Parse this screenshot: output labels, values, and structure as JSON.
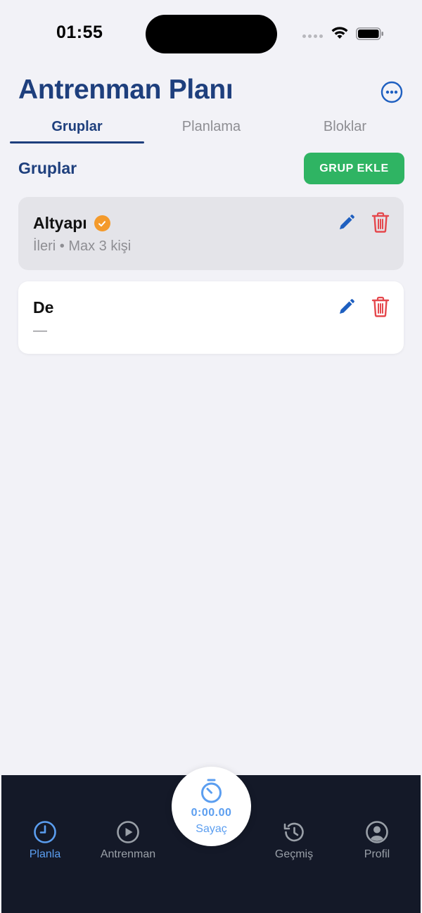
{
  "status_bar": {
    "time": "01:55"
  },
  "header": {
    "title": "Antrenman Planı"
  },
  "tabs": [
    {
      "label": "Gruplar",
      "active": true
    },
    {
      "label": "Planlama",
      "active": false
    },
    {
      "label": "Bloklar",
      "active": false
    }
  ],
  "section": {
    "title": "Gruplar",
    "add_button_label": "GRUP EKLE"
  },
  "groups": [
    {
      "name": "Altyapı",
      "verified": true,
      "meta": "İleri • Max 3 kişi",
      "selected": true
    },
    {
      "name": "De",
      "verified": false,
      "meta": "—",
      "selected": false
    }
  ],
  "tabbar": {
    "items": [
      {
        "label": "Planla",
        "icon": "clock-icon",
        "active": true
      },
      {
        "label": "Antrenman",
        "icon": "play-icon",
        "active": false
      },
      {
        "label": "Geçmiş",
        "icon": "history-icon",
        "active": false
      },
      {
        "label": "Profil",
        "icon": "profile-icon",
        "active": false
      }
    ],
    "timer": {
      "value": "0:00.00",
      "label": "Sayaç",
      "icon": "stopwatch-icon"
    }
  },
  "colors": {
    "primary": "#1e3f7d",
    "accent_blue": "#5b9ef0",
    "add_green": "#2fb463",
    "delete_red": "#e5484d",
    "badge_orange": "#f49a2b",
    "tabbar_bg": "#141928"
  }
}
